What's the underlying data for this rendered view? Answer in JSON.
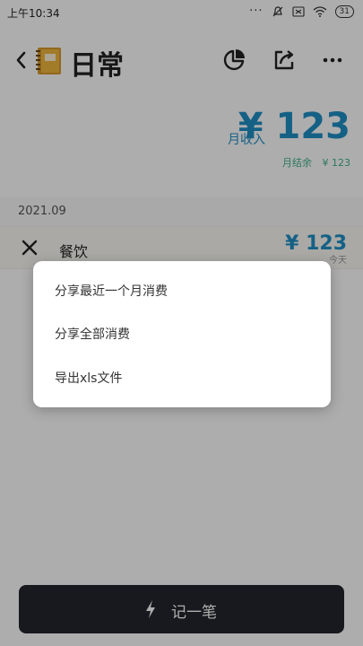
{
  "status_bar": {
    "time": "上午10:34",
    "dots": "···",
    "battery": "31"
  },
  "header": {
    "title": "日常"
  },
  "summary": {
    "income_label": "月收入",
    "income_value": "¥ 123",
    "balance_label": "月结余",
    "balance_value": "¥ 123"
  },
  "month": "2021.09",
  "records": [
    {
      "category": "餐饮",
      "amount": "¥ 123",
      "date": "今天"
    }
  ],
  "share_menu": {
    "items": [
      "分享最近一个月消费",
      "分享全部消费",
      "导出xls文件"
    ]
  },
  "bottom_button": {
    "label": "记一笔"
  },
  "colors": {
    "accent": "#1f8fc6",
    "balance": "#3fb08a",
    "button_bg": "#24252e",
    "overlay": "rgba(0,0,0,0.32)"
  },
  "icons": [
    "back-arrow-icon",
    "notebook-icon",
    "pie-chart-icon",
    "share-icon",
    "more-icon",
    "fork-knife-icon",
    "lightning-icon"
  ]
}
